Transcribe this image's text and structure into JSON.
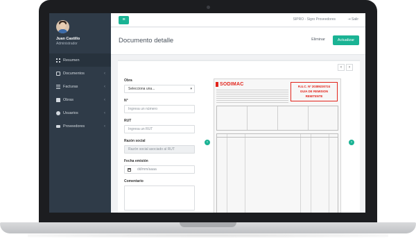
{
  "app": {
    "title": "SIPRO - Sigro Proveedores",
    "logout_label": "Salir",
    "menu_icon": "hamburger-icon"
  },
  "user": {
    "name": "Juan Castillo",
    "role": "Administrador"
  },
  "sidebar": {
    "items": [
      {
        "label": "Resumen",
        "icon": "dashboard-icon",
        "has_children": false
      },
      {
        "label": "Documentos",
        "icon": "documents-icon",
        "has_children": true
      },
      {
        "label": "Facturas",
        "icon": "invoices-icon",
        "has_children": true
      },
      {
        "label": "Obras",
        "icon": "buildings-icon",
        "has_children": true
      },
      {
        "label": "Usuarios",
        "icon": "users-icon",
        "has_children": true
      },
      {
        "label": "Proveedores",
        "icon": "truck-icon",
        "has_children": true
      }
    ]
  },
  "page": {
    "title": "Documento detalle",
    "delete_label": "Eliminar",
    "update_label": "Actualizar"
  },
  "form": {
    "obra": {
      "label": "Obra",
      "value": "Selecciona una..."
    },
    "numero": {
      "label": "N°",
      "placeholder": "Ingresa un número"
    },
    "rut": {
      "label": "RUT",
      "placeholder": "Ingresa un RUT"
    },
    "razon_social": {
      "label": "Razón social",
      "placeholder": "Razón social asociado al RUT"
    },
    "fecha": {
      "label": "Fecha emisión",
      "placeholder": "dd/mm/aaaa"
    },
    "comentario": {
      "label": "Comentario"
    }
  },
  "document": {
    "brand": "SODIMAC",
    "ruc_line1": "R.U.C. Nº 20389230724",
    "ruc_line2": "GUIA DE REMISION",
    "ruc_line3": "REMITENTE"
  },
  "colors": {
    "accent": "#1ab394",
    "sidebar": "#2f3b48",
    "brand_red": "#e2231a"
  }
}
